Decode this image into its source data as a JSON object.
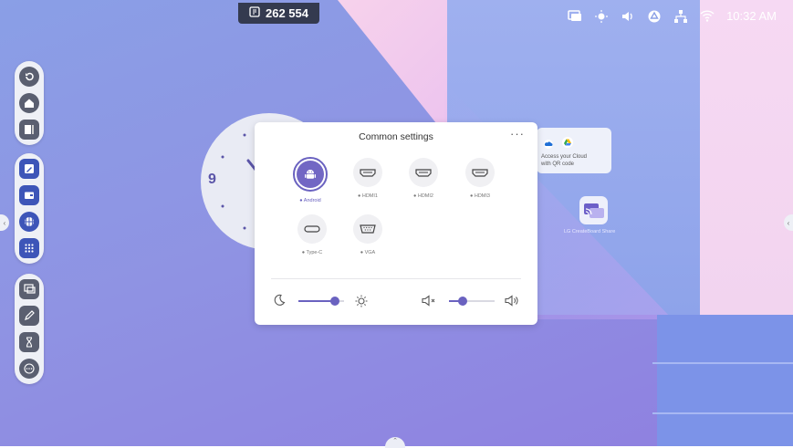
{
  "topbar": {
    "counter": "262 554",
    "time": "10:32 AM"
  },
  "status_icons": [
    "screen-share-icon",
    "brightness-icon",
    "volume-icon",
    "drive-icon",
    "network-icon",
    "wifi-icon"
  ],
  "clock": {
    "number": "9"
  },
  "cloud_widget": {
    "text": "Access your Cloud with QR code"
  },
  "cast_app": {
    "label": "LG CreateBoard Share"
  },
  "common_settings": {
    "title": "Common settings",
    "more": "···",
    "sources": [
      {
        "label": "Android",
        "selected": true
      },
      {
        "label": "HDMI1",
        "selected": false
      },
      {
        "label": "HDMI2",
        "selected": false
      },
      {
        "label": "HDMI3",
        "selected": false
      },
      {
        "label": "Type-C",
        "selected": false
      },
      {
        "label": "VGA",
        "selected": false
      }
    ],
    "brightness": 0.8,
    "volume": 0.3
  },
  "colors": {
    "accent": "#6a62c0",
    "toolbar_bg": "#eef0f6"
  }
}
